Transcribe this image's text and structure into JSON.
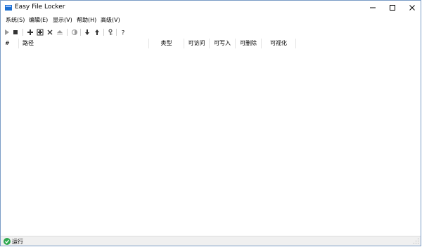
{
  "window": {
    "title": "Easy File Locker"
  },
  "menu": [
    "系统(S)",
    "编辑(E)",
    "显示(V)",
    "帮助(H)",
    "高级(V)"
  ],
  "table": {
    "columns": [
      "#",
      "路径",
      "类型",
      "可访问",
      "可写入",
      "可删除",
      "可视化"
    ]
  },
  "status": {
    "text": "运行"
  },
  "colors": {
    "accent": "#1c6fd1",
    "status_ok": "#2fa84f",
    "border": "#7a9cc6"
  },
  "toolbar_icons": [
    "play-icon",
    "stop-icon",
    "add-icon",
    "edit-icon",
    "delete-icon",
    "eject-icon",
    "toggle-icon",
    "arrow-down-icon",
    "arrow-up-icon",
    "key-icon",
    "help-icon"
  ]
}
